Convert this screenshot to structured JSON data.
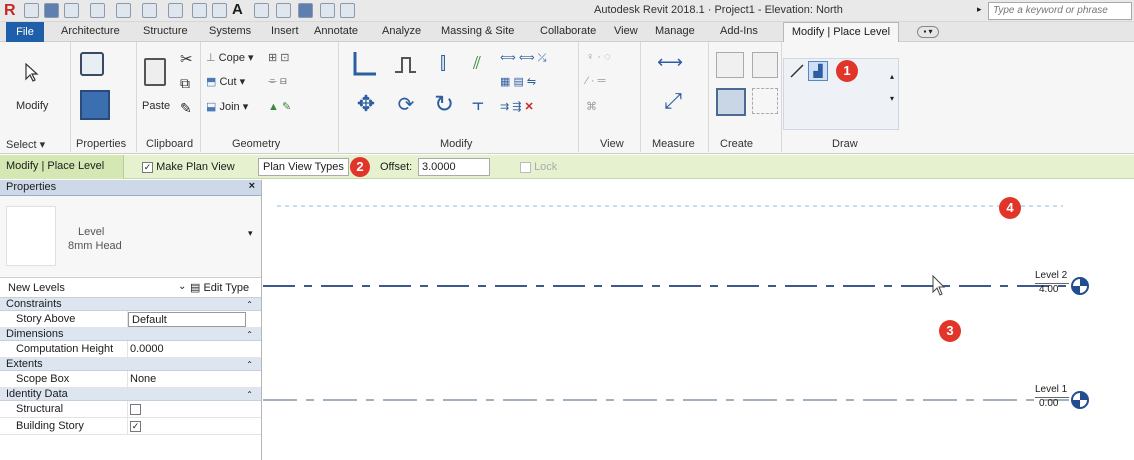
{
  "qat": {
    "title": "Autodesk Revit 2018.1   ·   Project1 - Elevation: North",
    "search_placeholder": "Type a keyword or phrase"
  },
  "menu": {
    "file": "File",
    "tabs": [
      "Architecture",
      "Structure",
      "Systems",
      "Insert",
      "Annotate",
      "Analyze",
      "Massing & Site",
      "Collaborate",
      "View",
      "Manage",
      "Add-Ins"
    ],
    "active_tab": "Modify | Place Level"
  },
  "ribbon": {
    "modify_label": "Modify",
    "paste_label": "Paste",
    "cope_label": "Cope",
    "cut_label": "Cut",
    "join_label": "Join",
    "groups": {
      "select": "Select ▾",
      "properties": "Properties",
      "clipboard": "Clipboard",
      "geometry": "Geometry",
      "modify": "Modify",
      "view": "View",
      "measure": "Measure",
      "create": "Create",
      "draw": "Draw"
    }
  },
  "options": {
    "context": "Modify | Place Level",
    "make_plan_view": "Make Plan View",
    "plan_view_types": "Plan View Types",
    "offset_label": "Offset:",
    "offset_value": "3.0000",
    "lock_label": "Lock"
  },
  "properties": {
    "header": "Properties",
    "close": "×",
    "type_name": "Level",
    "type_sub": "8mm Head",
    "instance": "New Levels",
    "edit_type": "Edit Type",
    "categories": {
      "constraints": "Constraints",
      "dimensions": "Dimensions",
      "extents": "Extents",
      "identity": "Identity Data"
    },
    "rows": {
      "story_above": {
        "name": "Story Above",
        "value": "Default"
      },
      "comp_height": {
        "name": "Computation Height",
        "value": "0.0000"
      },
      "scope_box": {
        "name": "Scope Box",
        "value": "None"
      },
      "structural": {
        "name": "Structural"
      },
      "building_story": {
        "name": "Building Story"
      }
    }
  },
  "canvas": {
    "level2_name": "Level 2",
    "level2_elev": "4.00",
    "level1_name": "Level 1",
    "level1_elev": "0.00"
  },
  "badges": [
    "1",
    "2",
    "3",
    "4"
  ],
  "colors": {
    "file_tab": "#1f5ea8",
    "options_bar": "#e6f2cf",
    "badge": "#e2352a",
    "level_line": "#3d5a8c"
  }
}
